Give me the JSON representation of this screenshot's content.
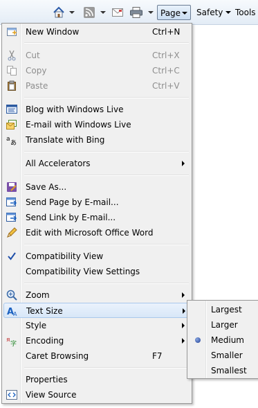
{
  "toolbar": {
    "page_label": "Page",
    "safety_label": "Safety",
    "tools_label": "Tools",
    "icons": [
      "home-icon",
      "rss-feed-icon",
      "read-mail-icon",
      "print-icon"
    ]
  },
  "menu": {
    "new_window": {
      "label": "New Window",
      "shortcut": "Ctrl+N"
    },
    "cut": {
      "label": "Cut",
      "shortcut": "Ctrl+X"
    },
    "copy": {
      "label": "Copy",
      "shortcut": "Ctrl+C"
    },
    "paste": {
      "label": "Paste",
      "shortcut": "Ctrl+V"
    },
    "blog": {
      "label": "Blog with Windows Live"
    },
    "email_live": {
      "label": "E-mail with Windows Live"
    },
    "translate": {
      "label": "Translate with Bing"
    },
    "all_accelerators": {
      "label": "All Accelerators"
    },
    "save_as": {
      "label": "Save As..."
    },
    "send_page": {
      "label": "Send Page by E-mail..."
    },
    "send_link": {
      "label": "Send Link by E-mail..."
    },
    "edit_word": {
      "label": "Edit with Microsoft Office Word"
    },
    "compat_view": {
      "label": "Compatibility View",
      "checked": true
    },
    "compat_settings": {
      "label": "Compatibility View Settings"
    },
    "zoom": {
      "label": "Zoom"
    },
    "text_size": {
      "label": "Text Size"
    },
    "style": {
      "label": "Style"
    },
    "encoding": {
      "label": "Encoding"
    },
    "caret_browsing": {
      "label": "Caret Browsing",
      "shortcut": "F7"
    },
    "properties": {
      "label": "Properties"
    },
    "view_source": {
      "label": "View Source"
    }
  },
  "text_size_submenu": {
    "items": [
      "Largest",
      "Larger",
      "Medium",
      "Smaller",
      "Smallest"
    ],
    "selected": "Medium"
  }
}
